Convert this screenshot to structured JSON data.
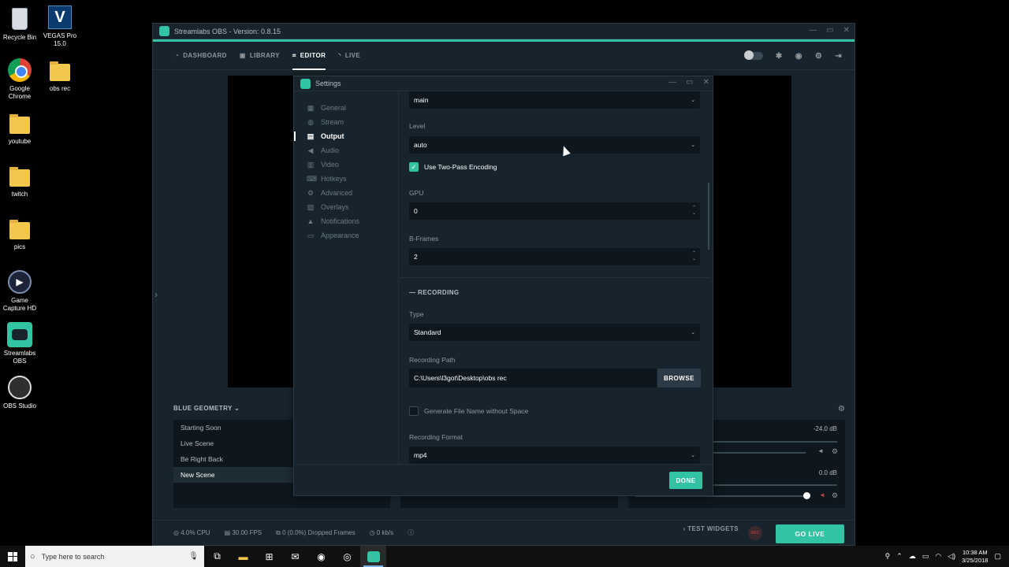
{
  "desktop": {
    "icons": [
      {
        "label": "Recycle Bin"
      },
      {
        "label": "VEGAS Pro 15.0"
      },
      {
        "label": "Google Chrome"
      },
      {
        "label": "obs rec"
      },
      {
        "label": "youtube"
      },
      {
        "label": "twitch"
      },
      {
        "label": "pics"
      },
      {
        "label": "Game Capture HD"
      },
      {
        "label": "Streamlabs OBS"
      },
      {
        "label": "OBS Studio"
      }
    ]
  },
  "app": {
    "title": "Streamlabs OBS - Version: 0.8.15",
    "nav": [
      {
        "label": "DASHBOARD",
        "icon": "dashboard-icon"
      },
      {
        "label": "LIBRARY",
        "icon": "library-icon"
      },
      {
        "label": "EDITOR",
        "icon": "editor-icon"
      },
      {
        "label": "LIVE",
        "icon": "live-icon"
      }
    ],
    "scenes_header": "BLUE GEOMETRY",
    "scenes": [
      "Starting Soon",
      "Live Scene",
      "Be Right Back",
      "New Scene"
    ],
    "mixer": {
      "db1": "-24.0 dB",
      "db2": "0.0 dB"
    },
    "status": {
      "cpu": "4.0% CPU",
      "fps": "30.00 FPS",
      "dropped": "0 (0.0%) Dropped Frames",
      "bandwidth": "0 kb/s"
    },
    "test_widgets": "TEST WIDGETS",
    "rec": "REC",
    "go_live": "GO LIVE",
    "accent_color": "#31c3a2"
  },
  "settings": {
    "title": "Settings",
    "nav": [
      {
        "label": "General",
        "icon": "general-icon"
      },
      {
        "label": "Stream",
        "icon": "stream-icon"
      },
      {
        "label": "Output",
        "icon": "output-icon"
      },
      {
        "label": "Audio",
        "icon": "audio-icon"
      },
      {
        "label": "Video",
        "icon": "video-icon"
      },
      {
        "label": "Hotkeys",
        "icon": "hotkeys-icon"
      },
      {
        "label": "Advanced",
        "icon": "advanced-icon"
      },
      {
        "label": "Overlays",
        "icon": "overlays-icon"
      },
      {
        "label": "Notifications",
        "icon": "notifications-icon"
      },
      {
        "label": "Appearance",
        "icon": "appearance-icon"
      }
    ],
    "profile_value": "main",
    "level_label": "Level",
    "level_value": "auto",
    "two_pass_label": "Use Two-Pass Encoding",
    "gpu_label": "GPU",
    "gpu_value": "0",
    "bframes_label": "B-Frames",
    "bframes_value": "2",
    "recording_header": "RECORDING",
    "type_label": "Type",
    "type_value": "Standard",
    "path_label": "Recording Path",
    "path_value": "C:\\Users\\l3got\\Desktop\\obs rec",
    "browse_label": "BROWSE",
    "gen_filename_label": "Generate File Name without Space",
    "format_label": "Recording Format",
    "format_value": "mp4",
    "done_label": "DONE"
  },
  "taskbar": {
    "search_placeholder": "Type here to search",
    "time": "10:38 AM",
    "date": "3/25/2018"
  }
}
